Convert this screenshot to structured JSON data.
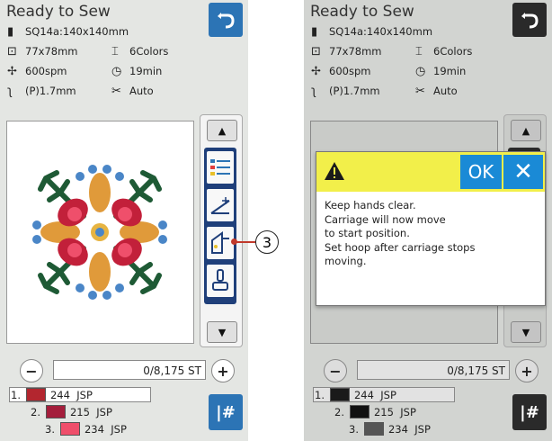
{
  "left": {
    "title": "Ready to Sew",
    "info": {
      "pattern_name": "SQ14a:140x140mm",
      "size": "77x78mm",
      "colors": "6Colors",
      "speed": "600spm",
      "time": "19min",
      "stitch": "(P)1.7mm",
      "thread": "Auto"
    },
    "stitch_counter": "0/8,175 ST",
    "color_list": [
      {
        "index": "1.",
        "code": "244",
        "brand": "JSP",
        "color": "#b3262f"
      },
      {
        "index": "2.",
        "code": "215",
        "brand": "JSP",
        "color": "#a41e3c"
      },
      {
        "index": "3.",
        "code": "234",
        "brand": "JSP",
        "color": "#ef4f6b"
      }
    ],
    "callout": "3"
  },
  "right": {
    "title": "Ready to Sew",
    "info": {
      "pattern_name": "SQ14a:140x140mm",
      "size": "77x78mm",
      "colors": "6Colors",
      "speed": "600spm",
      "time": "19min",
      "stitch": "(P)1.7mm",
      "thread": "Auto"
    },
    "stitch_counter": "0/8,175 ST",
    "color_list": [
      {
        "index": "1.",
        "code": "244",
        "brand": "JSP",
        "color": "#1a1a1a"
      },
      {
        "index": "2.",
        "code": "215",
        "brand": "JSP",
        "color": "#111111"
      },
      {
        "index": "3.",
        "code": "234",
        "brand": "JSP",
        "color": "#555555"
      }
    ],
    "dialog": {
      "ok_label": "OK",
      "close_label": "✕",
      "message_lines": [
        "Keep hands clear.",
        "Carriage will now move",
        "to start position.",
        "Set hoop after carriage stops",
        "moving."
      ]
    }
  },
  "buttons": {
    "minus": "−",
    "plus": "+",
    "up": "▲",
    "down": "▼",
    "jump": "|#"
  },
  "icons": {
    "back": "back-arrow-icon",
    "pattern": "pattern-icon",
    "size": "hoop-size-icon",
    "colors": "thread-spool-icon",
    "speed": "speed-icon",
    "time": "clock-icon",
    "stitch": "needle-icon",
    "thread": "scissors-icon"
  }
}
